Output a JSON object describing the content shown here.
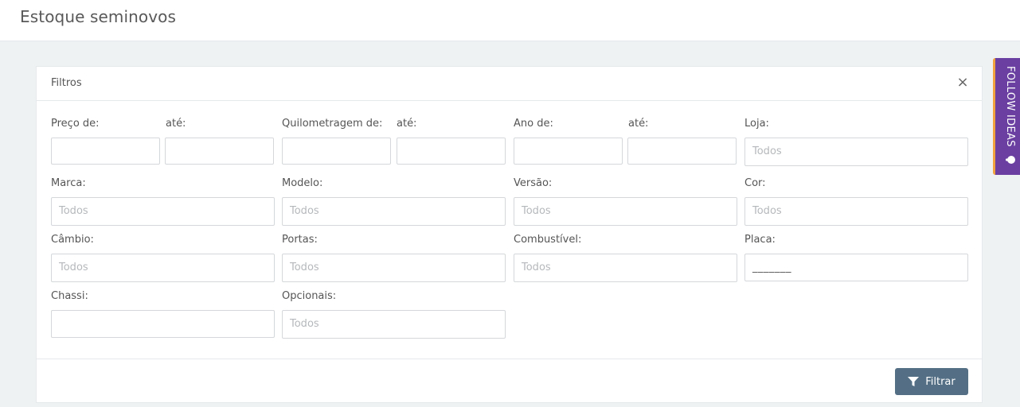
{
  "header": {
    "title": "Estoque seminovos"
  },
  "panel": {
    "title": "Filtros",
    "close_symbol": "×",
    "labels": {
      "preco_de": "Preço de:",
      "preco_ate": "até:",
      "km_de": "Quilometragem de:",
      "km_ate": "até:",
      "ano_de": "Ano de:",
      "ano_ate": "até:",
      "loja": "Loja:",
      "marca": "Marca:",
      "modelo": "Modelo:",
      "versao": "Versão:",
      "cor": "Cor:",
      "cambio": "Câmbio:",
      "portas": "Portas:",
      "combustivel": "Combustível:",
      "placa": "Placa:",
      "chassi": "Chassi:",
      "opcionais": "Opcionais:"
    },
    "values": {
      "loja": "Todos",
      "marca": "Todos",
      "modelo": "Todos",
      "versao": "Todos",
      "cor": "Todos",
      "cambio": "Todos",
      "portas": "Todos",
      "combustivel": "Todos",
      "placa": "_______",
      "opcionais": "Todos"
    },
    "filter_button": "Filtrar"
  },
  "side_tab": {
    "label": "FOLLOW IDEAS",
    "icon": "lightbulb-icon",
    "color": "#6a3fa1",
    "accent": "#f0a340"
  }
}
